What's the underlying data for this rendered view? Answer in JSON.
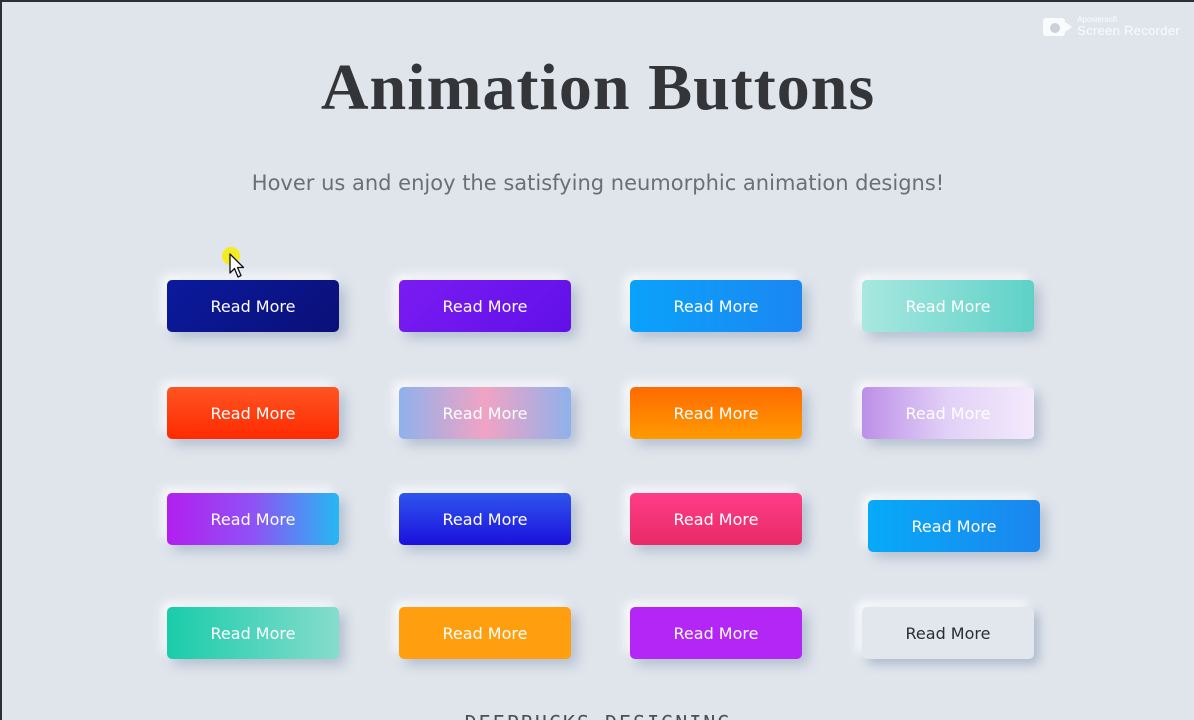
{
  "watermark": {
    "small": "Apowersoft",
    "big": "Screen Recorder"
  },
  "header": {
    "title": "Animation Buttons",
    "subtitle": "Hover us and enjoy the satisfying neumorphic animation designs!"
  },
  "buttons": [
    {
      "label": "Read More",
      "colors": [
        "#0b1a9e",
        "#0b1077"
      ]
    },
    {
      "label": "Read More",
      "colors": [
        "#7a1cf2",
        "#6010e8"
      ]
    },
    {
      "label": "Read More",
      "colors": [
        "#0aa2fb",
        "#1b87f2"
      ]
    },
    {
      "label": "Read More",
      "colors": [
        "#a8e8e0",
        "#5ed1c7"
      ]
    },
    {
      "label": "Read More",
      "colors": [
        "#ff5522",
        "#ff2a00"
      ]
    },
    {
      "label": "Read More",
      "colors": [
        "#8fb1ec",
        "#f1a3c4"
      ]
    },
    {
      "label": "Read More",
      "colors": [
        "#ff6a00",
        "#ff9a00"
      ]
    },
    {
      "label": "Read More",
      "colors": [
        "#bc8fe8",
        "#f3eafc"
      ]
    },
    {
      "label": "Read More",
      "colors": [
        "#b21ff0",
        "#25b8f2"
      ]
    },
    {
      "label": "Read More",
      "colors": [
        "#2f55ee",
        "#1b10dc"
      ]
    },
    {
      "label": "Read More",
      "colors": [
        "#ff3d88",
        "#e82a66"
      ]
    },
    {
      "label": "Read More",
      "colors": [
        "#07aaf8",
        "#1b86ee"
      ]
    },
    {
      "label": "Read More",
      "colors": [
        "#19ccaa",
        "#86dccc"
      ]
    },
    {
      "label": "Read More",
      "colors": [
        "#ff9f0f"
      ]
    },
    {
      "label": "Read More",
      "colors": [
        "#b326f5"
      ]
    },
    {
      "label": "Read More",
      "colors": [
        "#e2e6ed"
      ]
    }
  ],
  "footer": {
    "text": "DEEPBUCKS DESIGNING"
  },
  "theme": {
    "background": "#e0e5ec",
    "title_color": "#333538",
    "subtitle_color": "#6b6e72"
  },
  "icons": {
    "watermark": "camera-icon",
    "cursor": "mouse-pointer-icon"
  }
}
